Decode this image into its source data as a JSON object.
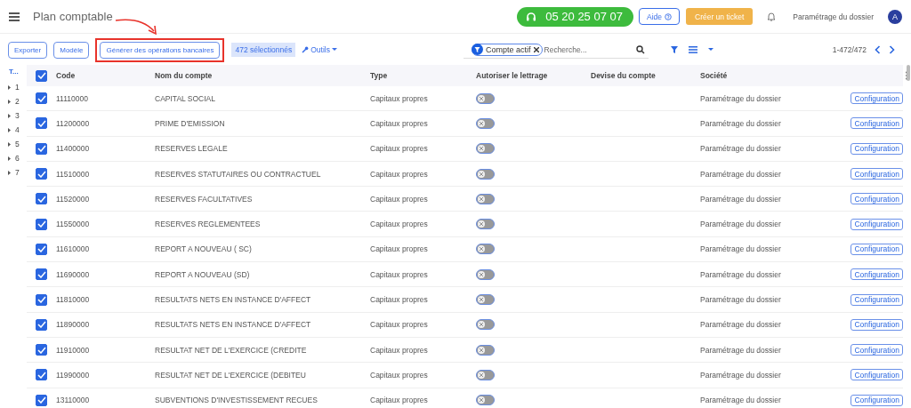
{
  "header": {
    "title": "Plan comptable",
    "phone": "05 20 25 07 07",
    "help": "Aide",
    "ticket": "Créer un ticket",
    "dossier": "Paramétrage du dossier",
    "avatar": "A"
  },
  "toolbar": {
    "buttons": [
      {
        "label": "Exporter",
        "highlighted": false
      },
      {
        "label": "Modèle",
        "highlighted": false
      },
      {
        "label": "Générer des opérations bancaires",
        "highlighted": true
      }
    ],
    "selection_count": "472 sélectionnés",
    "tools": "Outils",
    "filter_chip": "Compte actif",
    "search": {
      "placeholder": "Recherche..."
    },
    "pagination": "1-472/472"
  },
  "tree": {
    "header": "T...",
    "items": [
      {
        "label": "1",
        "expanded": false
      },
      {
        "label": "2",
        "expanded": false
      },
      {
        "label": "3",
        "expanded": false
      },
      {
        "label": "4",
        "expanded": false
      },
      {
        "label": "5",
        "expanded": false
      },
      {
        "label": "6",
        "expanded": false
      },
      {
        "label": "7",
        "expanded": false
      }
    ]
  },
  "table": {
    "select_all": {
      "checked": true
    },
    "columns": [
      "Code",
      "Nom du compte",
      "Type",
      "Autoriser le lettrage",
      "Devise du compte",
      "Société"
    ],
    "rows": [
      {
        "selected": true,
        "code": "11110000",
        "name": "CAPITAL SOCIAL",
        "type": "Capitaux propres",
        "lettrage": false,
        "societe": "Paramétrage du dossier",
        "action": "Configuration"
      },
      {
        "selected": true,
        "code": "11200000",
        "name": "PRIME D'EMISSION",
        "type": "Capitaux propres",
        "lettrage": false,
        "societe": "Paramétrage du dossier",
        "action": "Configuration"
      },
      {
        "selected": true,
        "code": "11400000",
        "name": "RESERVES LEGALE",
        "type": "Capitaux propres",
        "lettrage": false,
        "societe": "Paramétrage du dossier",
        "action": "Configuration"
      },
      {
        "selected": true,
        "code": "11510000",
        "name": "RESERVES STATUTAIRES OU CONTRACTUEL",
        "type": "Capitaux propres",
        "lettrage": false,
        "societe": "Paramétrage du dossier",
        "action": "Configuration"
      },
      {
        "selected": true,
        "code": "11520000",
        "name": "RESERVES FACULTATIVES",
        "type": "Capitaux propres",
        "lettrage": false,
        "societe": "Paramétrage du dossier",
        "action": "Configuration"
      },
      {
        "selected": true,
        "code": "11550000",
        "name": "RESERVES REGLEMENTEES",
        "type": "Capitaux propres",
        "lettrage": false,
        "societe": "Paramétrage du dossier",
        "action": "Configuration"
      },
      {
        "selected": true,
        "code": "11610000",
        "name": "REPORT A NOUVEAU ( SC)",
        "type": "Capitaux propres",
        "lettrage": false,
        "societe": "Paramétrage du dossier",
        "action": "Configuration"
      },
      {
        "selected": true,
        "code": "11690000",
        "name": "REPORT A NOUVEAU (SD)",
        "type": "Capitaux propres",
        "lettrage": false,
        "societe": "Paramétrage du dossier",
        "action": "Configuration"
      },
      {
        "selected": true,
        "code": "11810000",
        "name": "RESULTATS NETS EN INSTANCE D'AFFECT",
        "type": "Capitaux propres",
        "lettrage": false,
        "societe": "Paramétrage du dossier",
        "action": "Configuration"
      },
      {
        "selected": true,
        "code": "11890000",
        "name": "RESULTATS NETS EN INSTANCE D'AFFECT",
        "type": "Capitaux propres",
        "lettrage": false,
        "societe": "Paramétrage du dossier",
        "action": "Configuration"
      },
      {
        "selected": true,
        "code": "11910000",
        "name": "RESULTAT NET DE L'EXERCICE (CREDITE",
        "type": "Capitaux propres",
        "lettrage": false,
        "societe": "Paramétrage du dossier",
        "action": "Configuration"
      },
      {
        "selected": true,
        "code": "11990000",
        "name": "RESULTAT NET DE L'EXERCICE (DEBITEU",
        "type": "Capitaux propres",
        "lettrage": false,
        "societe": "Paramétrage du dossier",
        "action": "Configuration"
      },
      {
        "selected": true,
        "code": "13110000",
        "name": "SUBVENTIONS D'INVESTISSEMENT RECUES",
        "type": "Capitaux propres",
        "lettrage": false,
        "societe": "Paramétrage du dossier",
        "action": "Configuration"
      }
    ]
  }
}
